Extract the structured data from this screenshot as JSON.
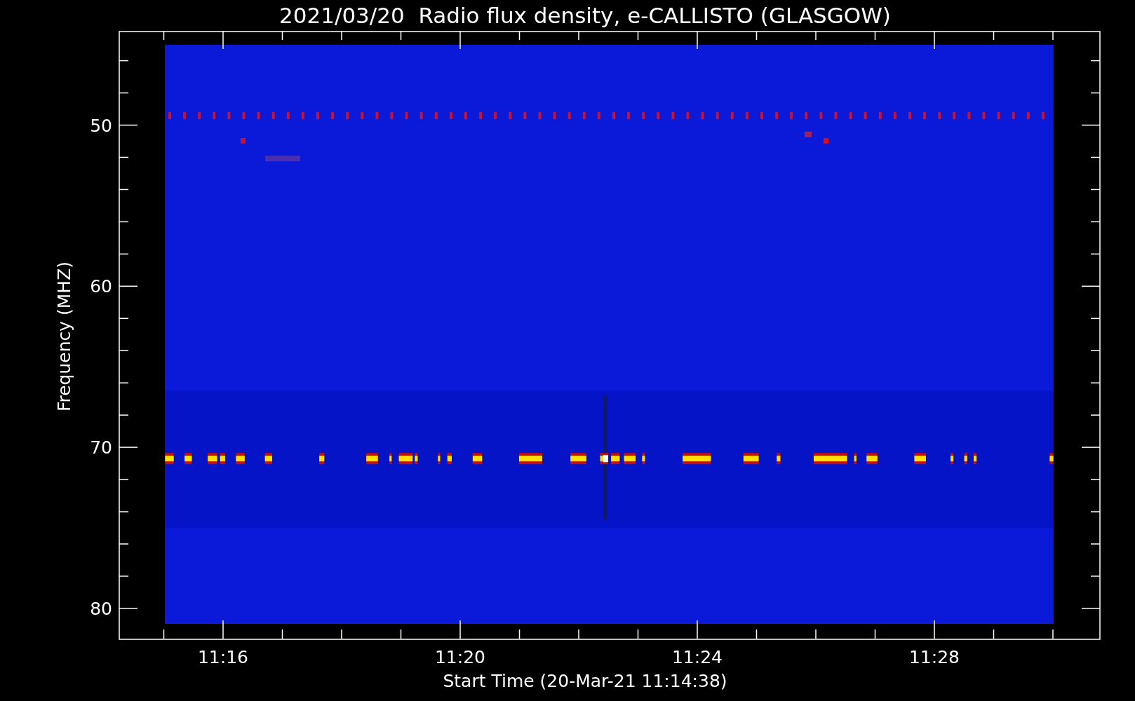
{
  "title": "2021/03/20  Radio flux density, e-CALLISTO (GLASGOW)",
  "plot": {
    "ylabel": "Frequency (MHZ)",
    "xlabel": "Start Time (20-Mar-21 11:14:38)",
    "yticks": [
      "50",
      "60",
      "70",
      "80"
    ],
    "xticks": [
      "11:16",
      "11:20",
      "11:24",
      "11:28"
    ]
  }
}
